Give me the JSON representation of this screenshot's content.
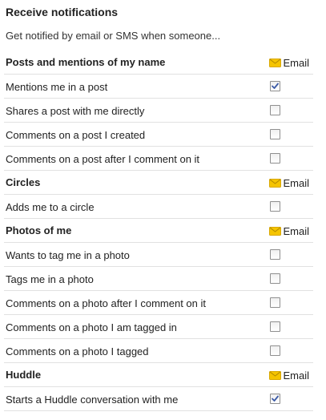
{
  "page": {
    "title": "Receive notifications",
    "subtitle": "Get notified by email or SMS when someone..."
  },
  "sections": [
    {
      "title": "Posts and mentions of my name",
      "email_label": "Email",
      "icon": "envelope-icon",
      "items": [
        {
          "label": "Mentions me in a post",
          "checked": true
        },
        {
          "label": "Shares a post with me directly",
          "checked": false
        },
        {
          "label": "Comments on a post I created",
          "checked": false
        },
        {
          "label": "Comments on a post after I comment on it",
          "checked": false
        }
      ]
    },
    {
      "title": "Circles",
      "email_label": "Email",
      "icon": "envelope-icon",
      "items": [
        {
          "label": "Adds me to a circle",
          "checked": false
        }
      ]
    },
    {
      "title": "Photos of me",
      "email_label": "Email",
      "icon": "envelope-icon",
      "items": [
        {
          "label": "Wants to tag me in a photo",
          "checked": false
        },
        {
          "label": "Tags me in a photo",
          "checked": false
        },
        {
          "label": "Comments on a photo after I comment on it",
          "checked": false
        },
        {
          "label": "Comments on a photo I am tagged in",
          "checked": false
        },
        {
          "label": "Comments on a photo I tagged",
          "checked": false
        }
      ]
    },
    {
      "title": "Huddle",
      "email_label": "Email",
      "icon": "envelope-icon",
      "items": [
        {
          "label": "Starts a Huddle conversation with me",
          "checked": true
        }
      ]
    }
  ],
  "colors": {
    "envelope": "#f5c400",
    "check": "#3b5aa6",
    "divider": "#e1e1e1"
  }
}
